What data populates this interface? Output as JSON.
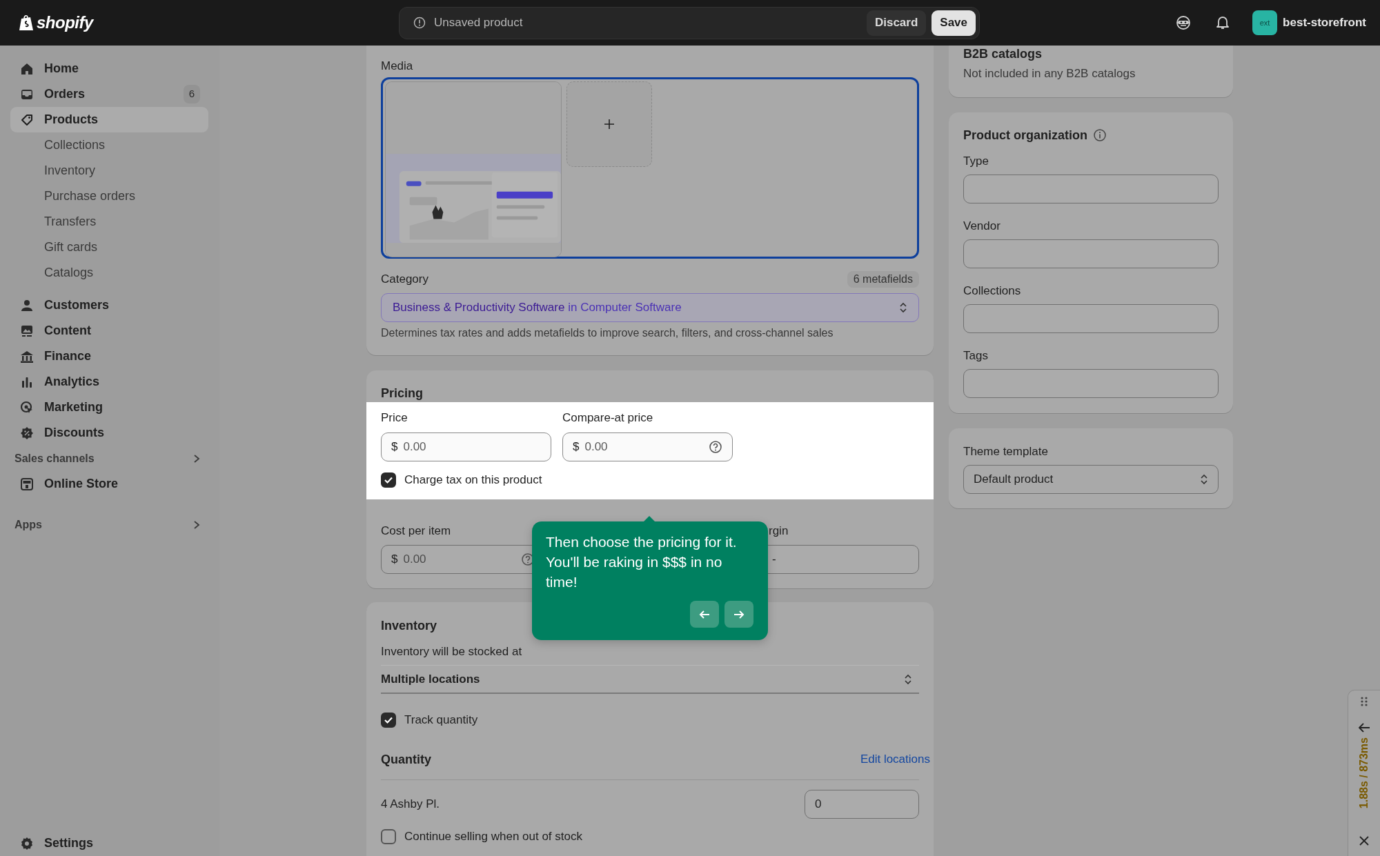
{
  "top_bar": {
    "logo": "shopify",
    "status": "Unsaved product",
    "buttons": [
      {
        "label": "Discard",
        "kind": "secondary"
      },
      {
        "label": "Save",
        "kind": "primary"
      }
    ],
    "avatar": "ext",
    "store": "best-storefront"
  },
  "sidebar": {
    "items": [
      {
        "kind": "main",
        "label": "Home",
        "selected": false
      },
      {
        "kind": "main",
        "label": "Orders",
        "badge": "6",
        "selected": false
      },
      {
        "kind": "main",
        "label": "Products",
        "selected": true
      },
      {
        "kind": "sub",
        "label": "Collections",
        "selected": false
      },
      {
        "kind": "sub",
        "label": "Inventory",
        "selected": false
      },
      {
        "kind": "sub",
        "label": "Purchase orders",
        "selected": false
      },
      {
        "kind": "sub",
        "label": "Transfers",
        "selected": false
      },
      {
        "kind": "sub",
        "label": "Gift cards",
        "selected": false
      },
      {
        "kind": "sub",
        "label": "Catalogs",
        "selected": false
      },
      {
        "kind": "main",
        "label": "Customers",
        "selected": false
      },
      {
        "kind": "main",
        "label": "Content",
        "selected": false
      },
      {
        "kind": "main",
        "label": "Finance",
        "selected": false
      },
      {
        "kind": "main",
        "label": "Analytics",
        "selected": false
      },
      {
        "kind": "main",
        "label": "Marketing",
        "selected": false
      },
      {
        "kind": "main",
        "label": "Discounts",
        "selected": false
      },
      {
        "kind": "section",
        "label": "Sales channels"
      },
      {
        "kind": "main",
        "label": "Online Store",
        "selected": false
      },
      {
        "kind": "section",
        "label": "Apps"
      }
    ],
    "footer": {
      "label": "Settings",
      "selected": false
    }
  },
  "media": {
    "label": "Media",
    "focused": true,
    "items": [
      {
        "kind": "picture"
      },
      {
        "kind": "add"
      }
    ]
  },
  "category": {
    "label": "Category",
    "badge": "6 metafields",
    "value": "Business & Productivity Software",
    "context": "in Computer Software",
    "help": "Determines tax rates and adds metafields to improve search, filters, and cross-channel sales"
  },
  "pricing": {
    "title": "Pricing",
    "highlighted": true,
    "fields": [
      {
        "label": "Price",
        "prefix": "$",
        "placeholder": "0.00",
        "help": false
      },
      {
        "label": "Compare-at price",
        "prefix": "$",
        "placeholder": "0.00",
        "help": true
      }
    ],
    "charge_tax": {
      "label": "Charge tax on this product",
      "checked": true
    },
    "cost": {
      "label": "Cost per item",
      "prefix": "$",
      "placeholder": "0.00",
      "help": true
    },
    "margin": {
      "label": "rgin",
      "value": "-"
    }
  },
  "tooltip": {
    "text": "Then choose the pricing for it. You'll be raking in $$$ in no time!"
  },
  "inventory": {
    "title": "Inventory",
    "stocked_label": "Inventory will be stocked at",
    "location_mode": "Multiple locations",
    "track": {
      "label": "Track quantity",
      "checked": true
    },
    "quantity_title": "Quantity",
    "edit_link": "Edit locations",
    "locations": [
      {
        "name": "4 Ashby Pl.",
        "quantity": "0"
      }
    ],
    "continue_selling": {
      "label": "Continue selling when out of stock",
      "checked": false
    }
  },
  "b2b": {
    "title": "B2B catalogs",
    "text": "Not included in any B2B catalogs"
  },
  "organization": {
    "title": "Product organization",
    "fields": [
      {
        "label": "Type"
      },
      {
        "label": "Vendor"
      },
      {
        "label": "Collections"
      },
      {
        "label": "Tags"
      }
    ]
  },
  "theme": {
    "label": "Theme template",
    "value": "Default product"
  },
  "perf": {
    "timing": "1.88s / 873ms"
  }
}
